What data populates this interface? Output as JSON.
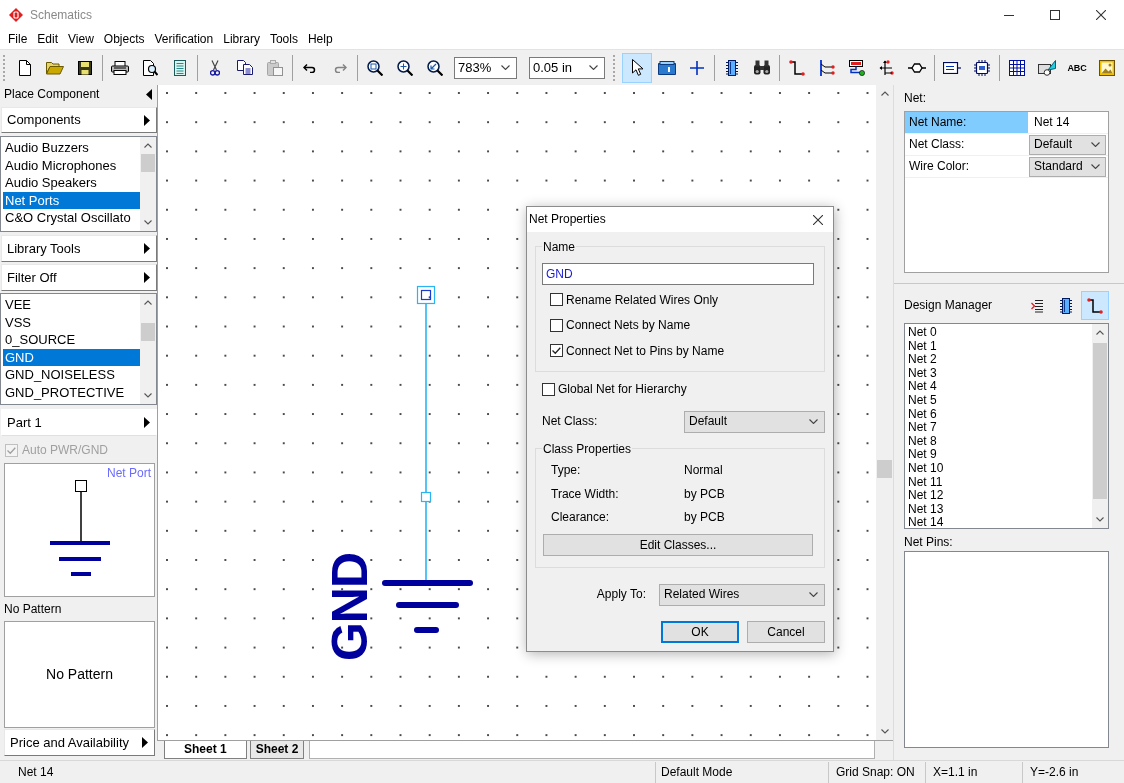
{
  "window": {
    "title": "Schematics"
  },
  "menu": [
    "File",
    "Edit",
    "View",
    "Objects",
    "Verification",
    "Library",
    "Tools",
    "Help"
  ],
  "toolbar": {
    "edit_tools": [
      {
        "disabled": false
      },
      {
        "disabled": false
      },
      {
        "disabled": true
      }
    ],
    "history_tools": [
      {
        "disabled": false
      },
      {
        "disabled": true
      }
    ],
    "zoom": "783%",
    "grid": "0.05 in",
    "mode_tools": [
      {
        "selected": true
      },
      {
        "selected": false
      },
      {
        "selected": false
      }
    ],
    "text_tool": "ABC"
  },
  "place_component": {
    "title": "Place Component",
    "category_button": "Components",
    "categories": [
      {
        "label": "Audio Buzzers",
        "selected": false
      },
      {
        "label": "Audio Microphones",
        "selected": false
      },
      {
        "label": "Audio Speakers",
        "selected": false
      },
      {
        "label": "Net Ports",
        "selected": true
      },
      {
        "label": "C&O Crystal Oscillato",
        "selected": false
      }
    ],
    "library_button": "Library Tools",
    "filter_button": "Filter Off",
    "parts": [
      {
        "label": "VEE",
        "selected": false
      },
      {
        "label": "VSS",
        "selected": false
      },
      {
        "label": "0_SOURCE",
        "selected": false
      },
      {
        "label": "GND",
        "selected": true
      },
      {
        "label": "GND_NOISELESS",
        "selected": false
      },
      {
        "label": "GND_PROTECTIVE",
        "selected": false
      }
    ],
    "part_button": "Part 1",
    "auto_pwr": {
      "label": "Auto PWR/GND",
      "checked": true,
      "disabled": true
    },
    "preview_caption": "Net Port",
    "pattern_title": "No Pattern",
    "pattern_preview": "No Pattern",
    "price_button": "Price and Availability"
  },
  "canvas": {
    "symbol_label": "GND"
  },
  "sheet_tabs": [
    {
      "label": "Sheet 1",
      "selected": true
    },
    {
      "label": "Sheet 2",
      "selected": false
    }
  ],
  "net_panel": {
    "title": "Net:",
    "properties": [
      {
        "label": "Net Name:",
        "value": "Net 14",
        "kind": "text",
        "selected": true
      },
      {
        "label": "Net Class:",
        "value": "Default",
        "kind": "select",
        "selected": false
      },
      {
        "label": "Wire Color:",
        "value": "Standard",
        "kind": "select",
        "selected": false
      }
    ]
  },
  "design_manager": {
    "title": "Design Manager",
    "views": [
      {
        "selected": false
      },
      {
        "selected": false
      },
      {
        "selected": true
      }
    ],
    "nets": [
      {
        "label": "Net 0",
        "selected": false
      },
      {
        "label": "Net 1",
        "selected": false
      },
      {
        "label": "Net 2",
        "selected": false
      },
      {
        "label": "Net 3",
        "selected": false
      },
      {
        "label": "Net 4",
        "selected": false
      },
      {
        "label": "Net 5",
        "selected": false
      },
      {
        "label": "Net 6",
        "selected": false
      },
      {
        "label": "Net 7",
        "selected": false
      },
      {
        "label": "Net 8",
        "selected": false
      },
      {
        "label": "Net 9",
        "selected": false
      },
      {
        "label": "Net 10",
        "selected": false
      },
      {
        "label": "Net 11",
        "selected": false
      },
      {
        "label": "Net 12",
        "selected": false
      },
      {
        "label": "Net 13",
        "selected": false
      },
      {
        "label": "Net 14",
        "selected": false
      }
    ],
    "pins_title": "Net Pins:"
  },
  "dialog": {
    "title": "Net Properties",
    "name_group": {
      "title": "Name",
      "value": "GND",
      "options": [
        {
          "label": "Rename Related Wires Only",
          "checked": false
        },
        {
          "label": "Connect Nets by Name",
          "checked": false
        },
        {
          "label": "Connect Net to Pins by Name",
          "checked": true
        }
      ]
    },
    "global_net": {
      "label": "Global Net for Hierarchy",
      "checked": false
    },
    "net_class": {
      "label": "Net Class:",
      "value": "Default"
    },
    "class_properties": {
      "title": "Class Properties",
      "rows": [
        {
          "label": "Type:",
          "value": "Normal"
        },
        {
          "label": "Trace Width:",
          "value": "by PCB"
        },
        {
          "label": "Clearance:",
          "value": "by PCB"
        }
      ],
      "button": "Edit Classes..."
    },
    "apply_to": {
      "label": "Apply To:",
      "value": "Related Wires"
    },
    "buttons": [
      {
        "label": "OK",
        "kind": "default"
      },
      {
        "label": "Cancel",
        "kind": "normal"
      }
    ]
  },
  "status_bar": [
    "Net 14",
    "Default Mode",
    "Grid Snap: ON",
    "X=1.1 in",
    "Y=-2.6 in"
  ]
}
